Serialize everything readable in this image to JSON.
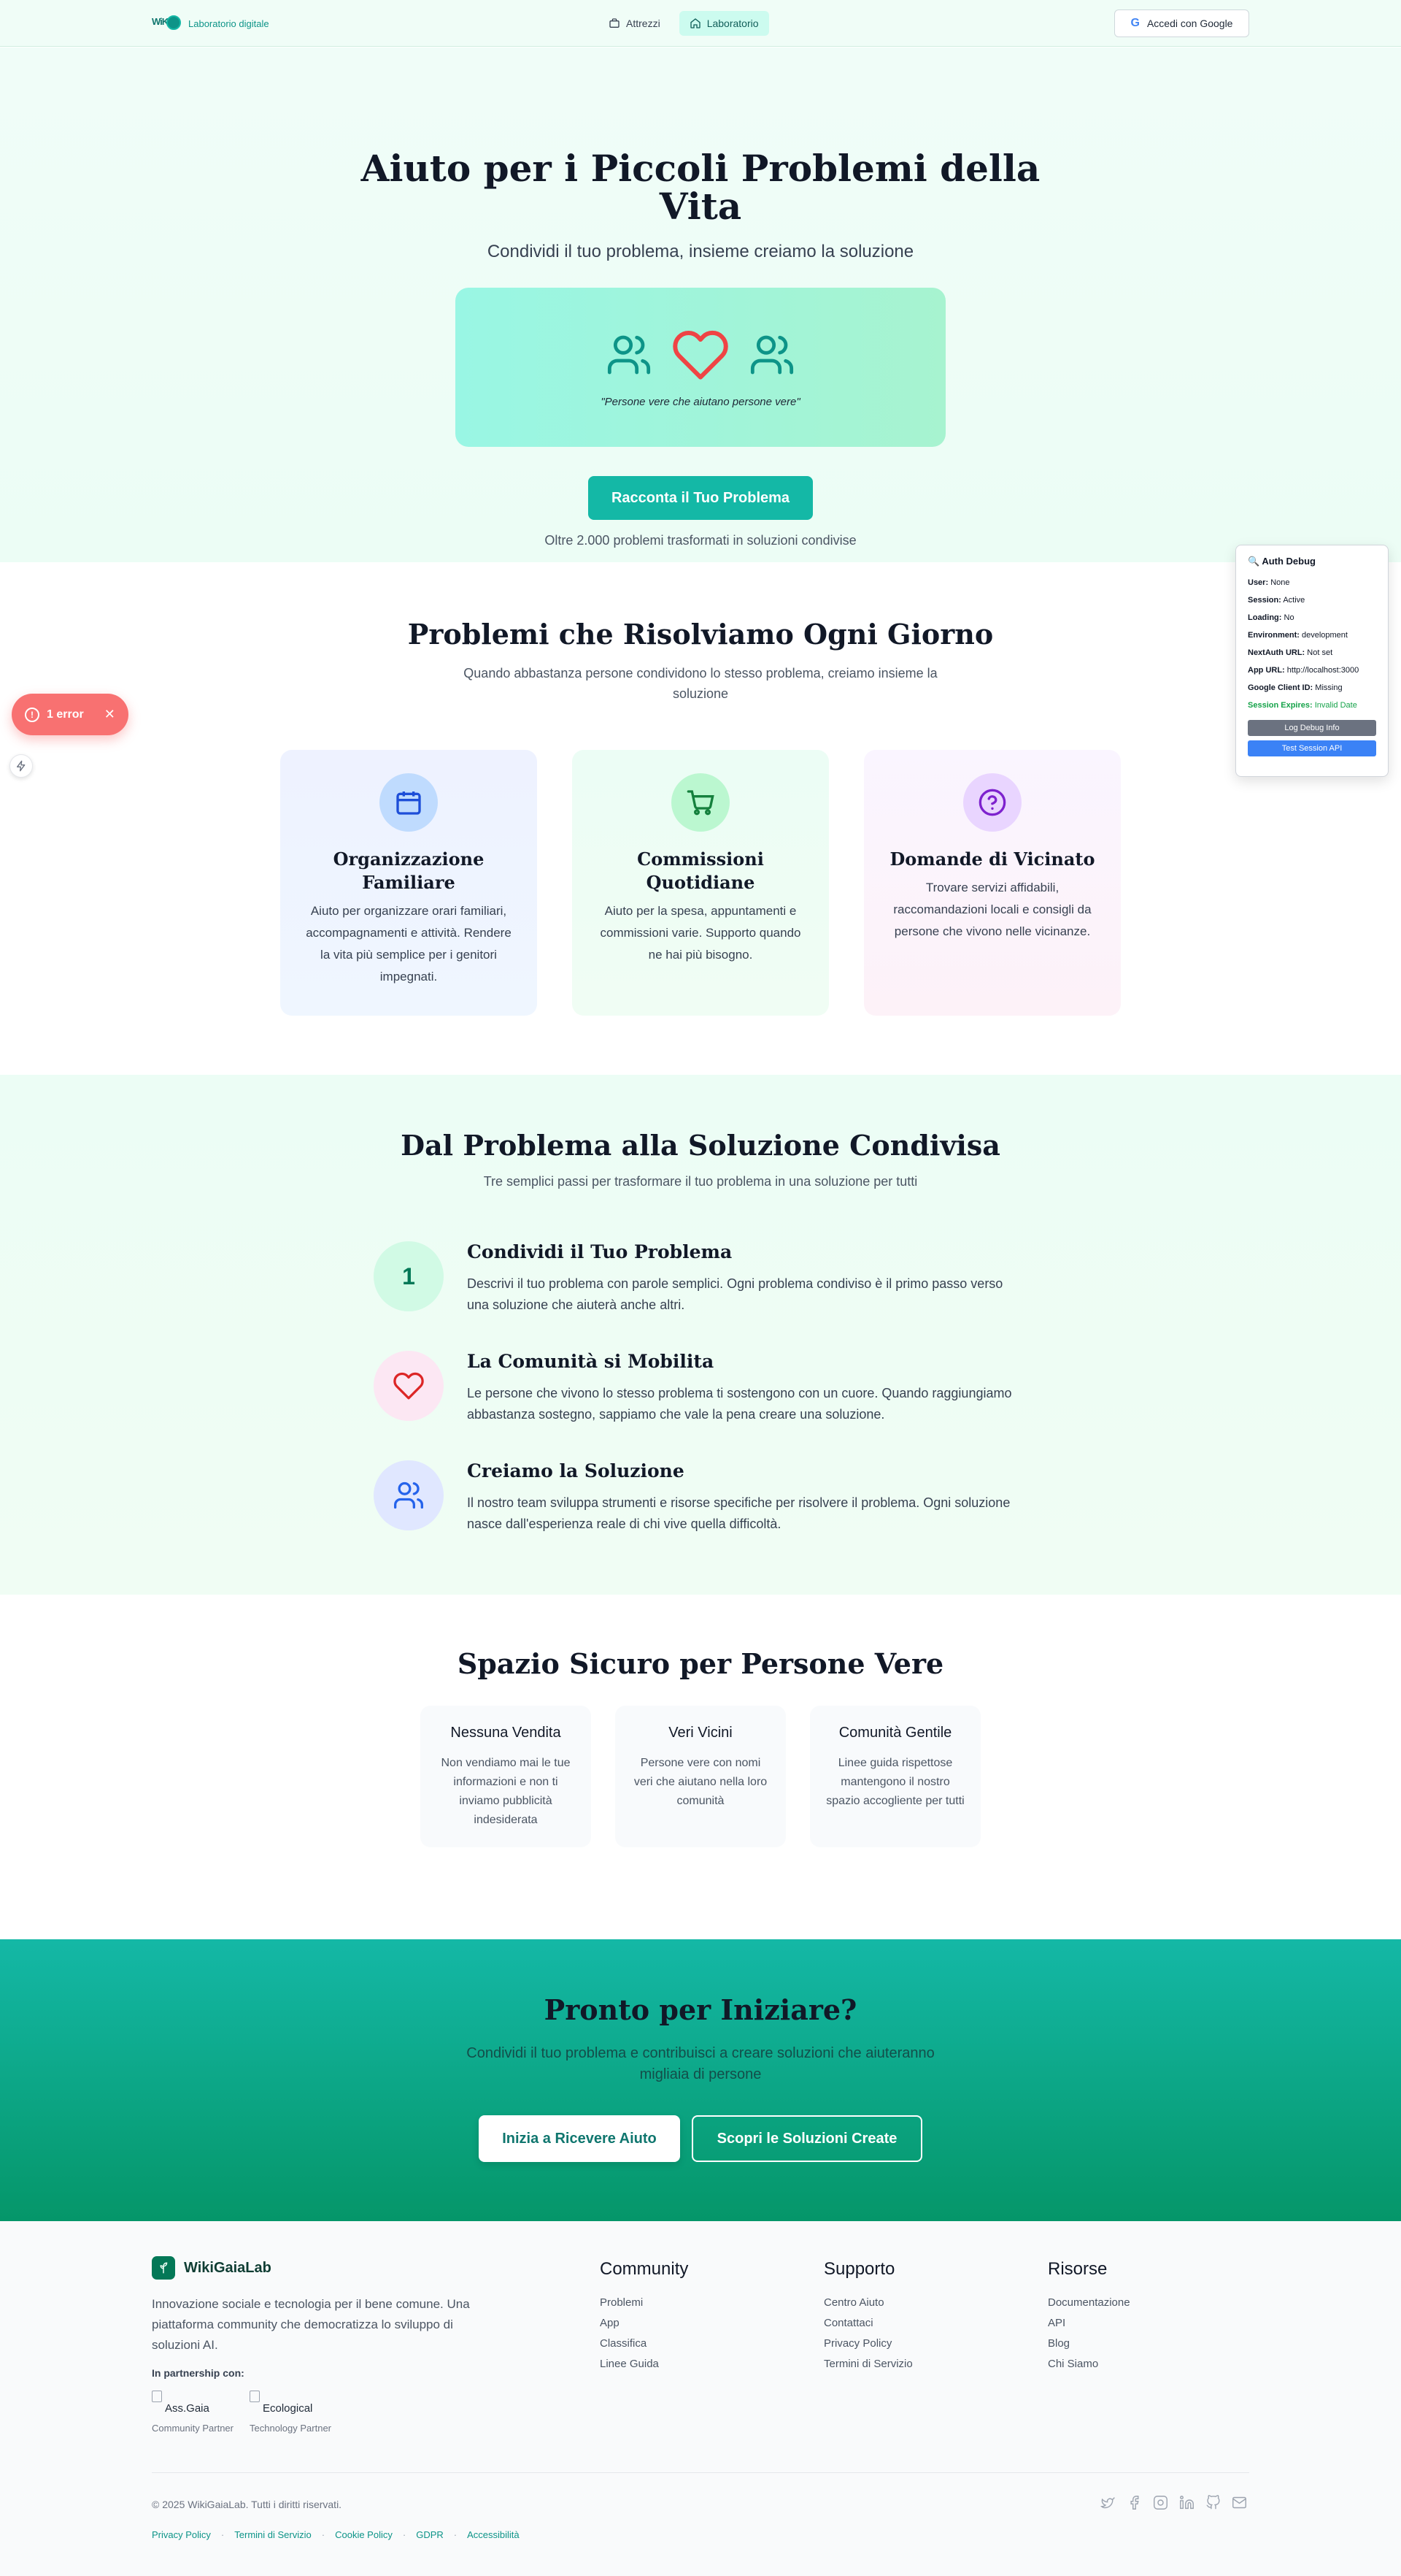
{
  "nav": {
    "logo_text": "WiKi",
    "tagline": "Laboratorio digitale",
    "links": [
      {
        "label": "Attrezzi",
        "icon": "briefcase-icon"
      },
      {
        "label": "Laboratorio",
        "icon": "home-icon"
      }
    ],
    "login_label": "Accedi con Google",
    "login_icon": "G"
  },
  "hero": {
    "title": "Aiuto per i Piccoli Problemi della Vita",
    "subtitle": "Condividi il tuo problema, insieme creiamo la soluzione",
    "quote": "\"Persone vere che aiutano persone vere\"",
    "cta_label": "Racconta il Tuo Problema",
    "note": "Oltre 2.000 problemi trasformati in soluzioni condivise"
  },
  "problems": {
    "title": "Problemi che Risolviamo Ogni Giorno",
    "subtitle": "Quando abbastanza persone condividono lo stesso problema, creiamo insieme la soluzione",
    "cards": [
      {
        "title": "Organizzazione Familiare",
        "text": "Aiuto per organizzare orari familiari, accompagnamenti e attività. Rendere la vita più semplice per i genitori impegnati.",
        "icon": "calendar-icon"
      },
      {
        "title": "Commissioni Quotidiane",
        "text": "Aiuto per la spesa, appuntamenti e commissioni varie. Supporto quando ne hai più bisogno.",
        "icon": "cart-icon"
      },
      {
        "title": "Domande di Vicinato",
        "text": "Trovare servizi affidabili, raccomandazioni locali e consigli da persone che vivono nelle vicinanze.",
        "icon": "question-icon"
      }
    ]
  },
  "steps": {
    "title": "Dal Problema alla Soluzione Condivisa",
    "subtitle": "Tre semplici passi per trasformare il tuo problema in una soluzione per tutti",
    "items": [
      {
        "number": "1",
        "title": "Condividi il Tuo Problema",
        "text": "Descrivi il tuo problema con parole semplici. Ogni problema condiviso è il primo passo verso una soluzione che aiuterà anche altri."
      },
      {
        "title": "La Comunità si Mobilita",
        "text": "Le persone che vivono lo stesso problema ti sostengono con un cuore. Quando raggiungiamo abbastanza sostegno, sappiamo che vale la pena creare una soluzione.",
        "icon": "heart-icon"
      },
      {
        "title": "Creiamo la Soluzione",
        "text": "Il nostro team sviluppa strumenti e risorse specifiche per risolvere il problema. Ogni soluzione nasce dall'esperienza reale di chi vive quella difficoltà.",
        "icon": "users-icon"
      }
    ]
  },
  "safe": {
    "title": "Spazio Sicuro per Persone Vere",
    "cards": [
      {
        "title": "Nessuna Vendita",
        "text": "Non vendiamo mai le tue informazioni e non ti inviamo pubblicità indesiderata"
      },
      {
        "title": "Veri Vicini",
        "text": "Persone vere con nomi veri che aiutano nella loro comunità"
      },
      {
        "title": "Comunità Gentile",
        "text": "Linee guida rispettose mantengono il nostro spazio accogliente per tutti"
      }
    ]
  },
  "cta": {
    "title": "Pronto per Iniziare?",
    "subtitle": "Condividi il tuo problema e contribuisci a creare soluzioni che aiuteranno migliaia di persone",
    "primary_label": "Inizia a Ricevere Aiuto",
    "secondary_label": "Scopri le Soluzioni Create"
  },
  "footer": {
    "brand": "WikiGaiaLab",
    "description": "Innovazione sociale e tecnologia per il bene comune. Una piattaforma community che democratizza lo sviluppo di soluzioni AI.",
    "partners_title": "In partnership con:",
    "partners": [
      {
        "alt": "Ass.Gaia",
        "caption": "Community Partner"
      },
      {
        "alt": "Ecological",
        "caption": "Technology Partner"
      }
    ],
    "columns": [
      {
        "title": "Community",
        "links": [
          "Problemi",
          "App",
          "Classifica",
          "Linee Guida"
        ]
      },
      {
        "title": "Supporto",
        "links": [
          "Centro Aiuto",
          "Contattaci",
          "Privacy Policy",
          "Termini di Servizio"
        ]
      },
      {
        "title": "Risorse",
        "links": [
          "Documentazione",
          "API",
          "Blog",
          "Chi Siamo"
        ]
      }
    ],
    "copyright": "© 2025 WikiGaiaLab. Tutti i diritti riservati.",
    "legal": [
      "Privacy Policy",
      "Termini di Servizio",
      "Cookie Policy",
      "GDPR",
      "Accessibilità"
    ],
    "social": [
      "twitter-icon",
      "facebook-icon",
      "instagram-icon",
      "linkedin-icon",
      "github-icon",
      "mail-icon"
    ]
  },
  "debug": {
    "title": "🔍 Auth Debug",
    "rows": [
      {
        "key": "User:",
        "value": "None"
      },
      {
        "key": "Session:",
        "value": "Active"
      },
      {
        "key": "Loading:",
        "value": "No"
      },
      {
        "key": "Environment:",
        "value": "development"
      },
      {
        "key": "NextAuth URL:",
        "value": "Not set"
      },
      {
        "key": "App URL:",
        "value": "http://localhost:3000"
      },
      {
        "key": "Google Client ID:",
        "value": "Missing"
      },
      {
        "key": "Session Expires:",
        "value": "Invalid Date"
      }
    ],
    "log_button": "Log Debug Info",
    "test_button": "Test Session API"
  },
  "error_toast": {
    "label": "1 error"
  },
  "colors": {
    "accent": "#14b8a6",
    "brand_dark": "#047857",
    "error": "#f87171",
    "debug_blue": "#3b82f6"
  }
}
